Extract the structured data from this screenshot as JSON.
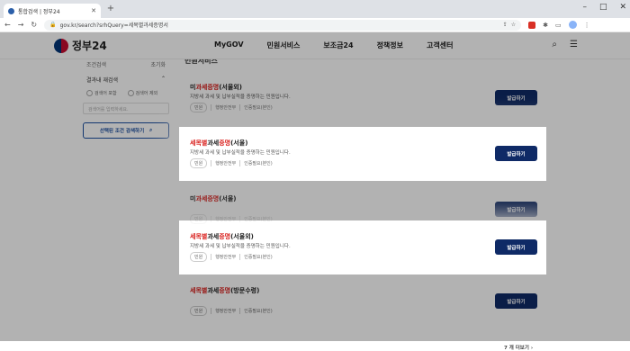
{
  "browser": {
    "tab_title": "통합검색 | 정부24",
    "new_tab": "+",
    "url": "gov.kr/search?srhQuery=세목별과세증명서",
    "window_controls": [
      "–",
      "□",
      "✕"
    ]
  },
  "header": {
    "logo_text": "정부24",
    "menu": [
      "MyGOV",
      "민원서비스",
      "보조금24",
      "정책정보",
      "고객센터"
    ]
  },
  "sidebar": {
    "condition_search": "조건검색",
    "reset": "초기화",
    "within_results_label": "결과내 재검색",
    "options": [
      "검색어 포함",
      "검색어 제외"
    ],
    "search_placeholder": "검색어를 입력하세요.",
    "apply_button": "선택된 조건 검색하기"
  },
  "content": {
    "section_title": "민원서비스",
    "more_link": "7 개 더보기",
    "cards": [
      {
        "prefix": "미",
        "highlight": "과세증명",
        "suffix": "(서울외)",
        "desc": "지방세 과세 및 납부실적을 증명하는 민원입니다.",
        "tags": [
          "민원",
          "행정안전부",
          "인증필요(본인)"
        ],
        "button": "발급하기",
        "highlighted": false
      },
      {
        "prefix": "",
        "highlight": "세목별",
        "mid": "과세",
        "highlight2": "증명",
        "suffix": "(서울)",
        "desc": "지방세 과세 및 납부실적을 증명하는 민원입니다.",
        "tags": [
          "민원",
          "행정안전부",
          "인증필요(본인)"
        ],
        "button": "발급하기",
        "highlighted": true
      },
      {
        "prefix": "미",
        "highlight": "과세증명",
        "suffix": "(서울)",
        "desc": "",
        "tags": [
          "민원",
          "행정안전부",
          "인증필요(본인)"
        ],
        "button": "발급하기",
        "highlighted": false
      },
      {
        "prefix": "",
        "highlight": "세목별",
        "mid": "과세",
        "highlight2": "증명",
        "suffix": "(서울외)",
        "desc": "지방세 과세 및 납부실적을 증명하는 민원입니다.",
        "tags": [
          "민원",
          "행정안전부",
          "인증필요(본인)"
        ],
        "button": "발급하기",
        "highlighted": true
      },
      {
        "prefix": "",
        "highlight": "세목별",
        "mid": "과세",
        "highlight2": "증명",
        "suffix": "(방문수령)",
        "desc": "",
        "tags": [
          "민원",
          "행정안전부",
          "인증필요(본인)"
        ],
        "button": "발급하기",
        "highlighted": false
      }
    ]
  }
}
